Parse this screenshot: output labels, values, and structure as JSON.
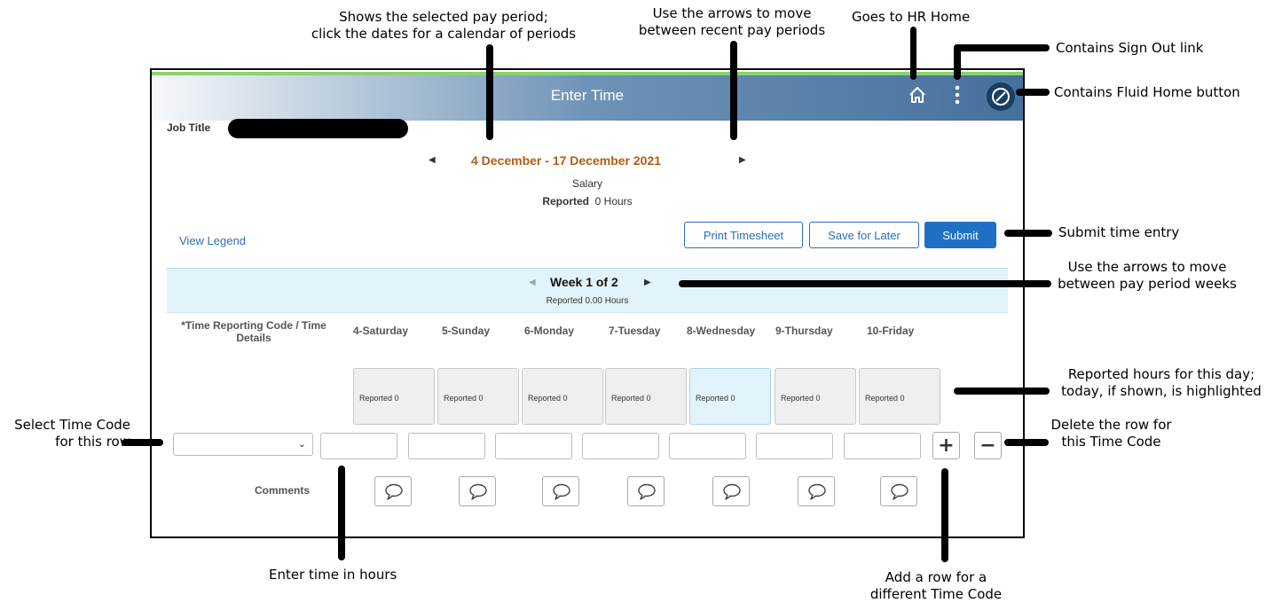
{
  "annotations": {
    "pay_period": [
      "Shows the selected pay period;",
      "click the dates for a calendar of periods"
    ],
    "pay_period_arrows": [
      "Use the arrows to move",
      "between recent pay periods"
    ],
    "hr_home": "Goes to HR Home",
    "sign_out": "Contains Sign Out link",
    "fluid_home": "Contains Fluid Home button",
    "submit": "Submit time entry",
    "week_arrows": [
      "Use the arrows to move",
      "between pay period weeks"
    ],
    "reported_hours": [
      "Reported hours for this day;",
      "today, if shown, is highlighted"
    ],
    "select_code": [
      "Select Time Code",
      "for this row"
    ],
    "delete_row": [
      "Delete the row for",
      "this Time Code"
    ],
    "enter_time": "Enter time in hours",
    "add_row": [
      "Add a row for a",
      "different Time Code"
    ]
  },
  "header": {
    "title": "Enter Time",
    "icons": [
      "home-icon",
      "more-vertical-icon",
      "navbar-compass-icon"
    ]
  },
  "job": {
    "label": "Job Title"
  },
  "period": {
    "dates": "4 December - 17 December 2021",
    "type": "Salary",
    "reported_label": "Reported",
    "reported_value": "0 Hours"
  },
  "actions": {
    "legend": "View Legend",
    "print": "Print Timesheet",
    "save": "Save for Later",
    "submit": "Submit"
  },
  "week": {
    "label": "Week 1 of 2",
    "reported": "Reported  0.00 Hours"
  },
  "grid": {
    "trc_header": "*Time Reporting Code / Time Details",
    "days": [
      "4-Saturday",
      "5-Sunday",
      "6-Monday",
      "7-Tuesday",
      "8-Wednesday",
      "9-Thursday",
      "10-Friday"
    ],
    "day_reported": [
      "Reported  0",
      "Reported  0",
      "Reported  0",
      "Reported  0",
      "Reported  0",
      "Reported  0",
      "Reported  0"
    ],
    "today_index": 4,
    "comments_label": "Comments"
  },
  "colors": {
    "accent": "#1f6fc4",
    "period_text": "#b35c12",
    "today_highlight": "#e2f3fb"
  }
}
